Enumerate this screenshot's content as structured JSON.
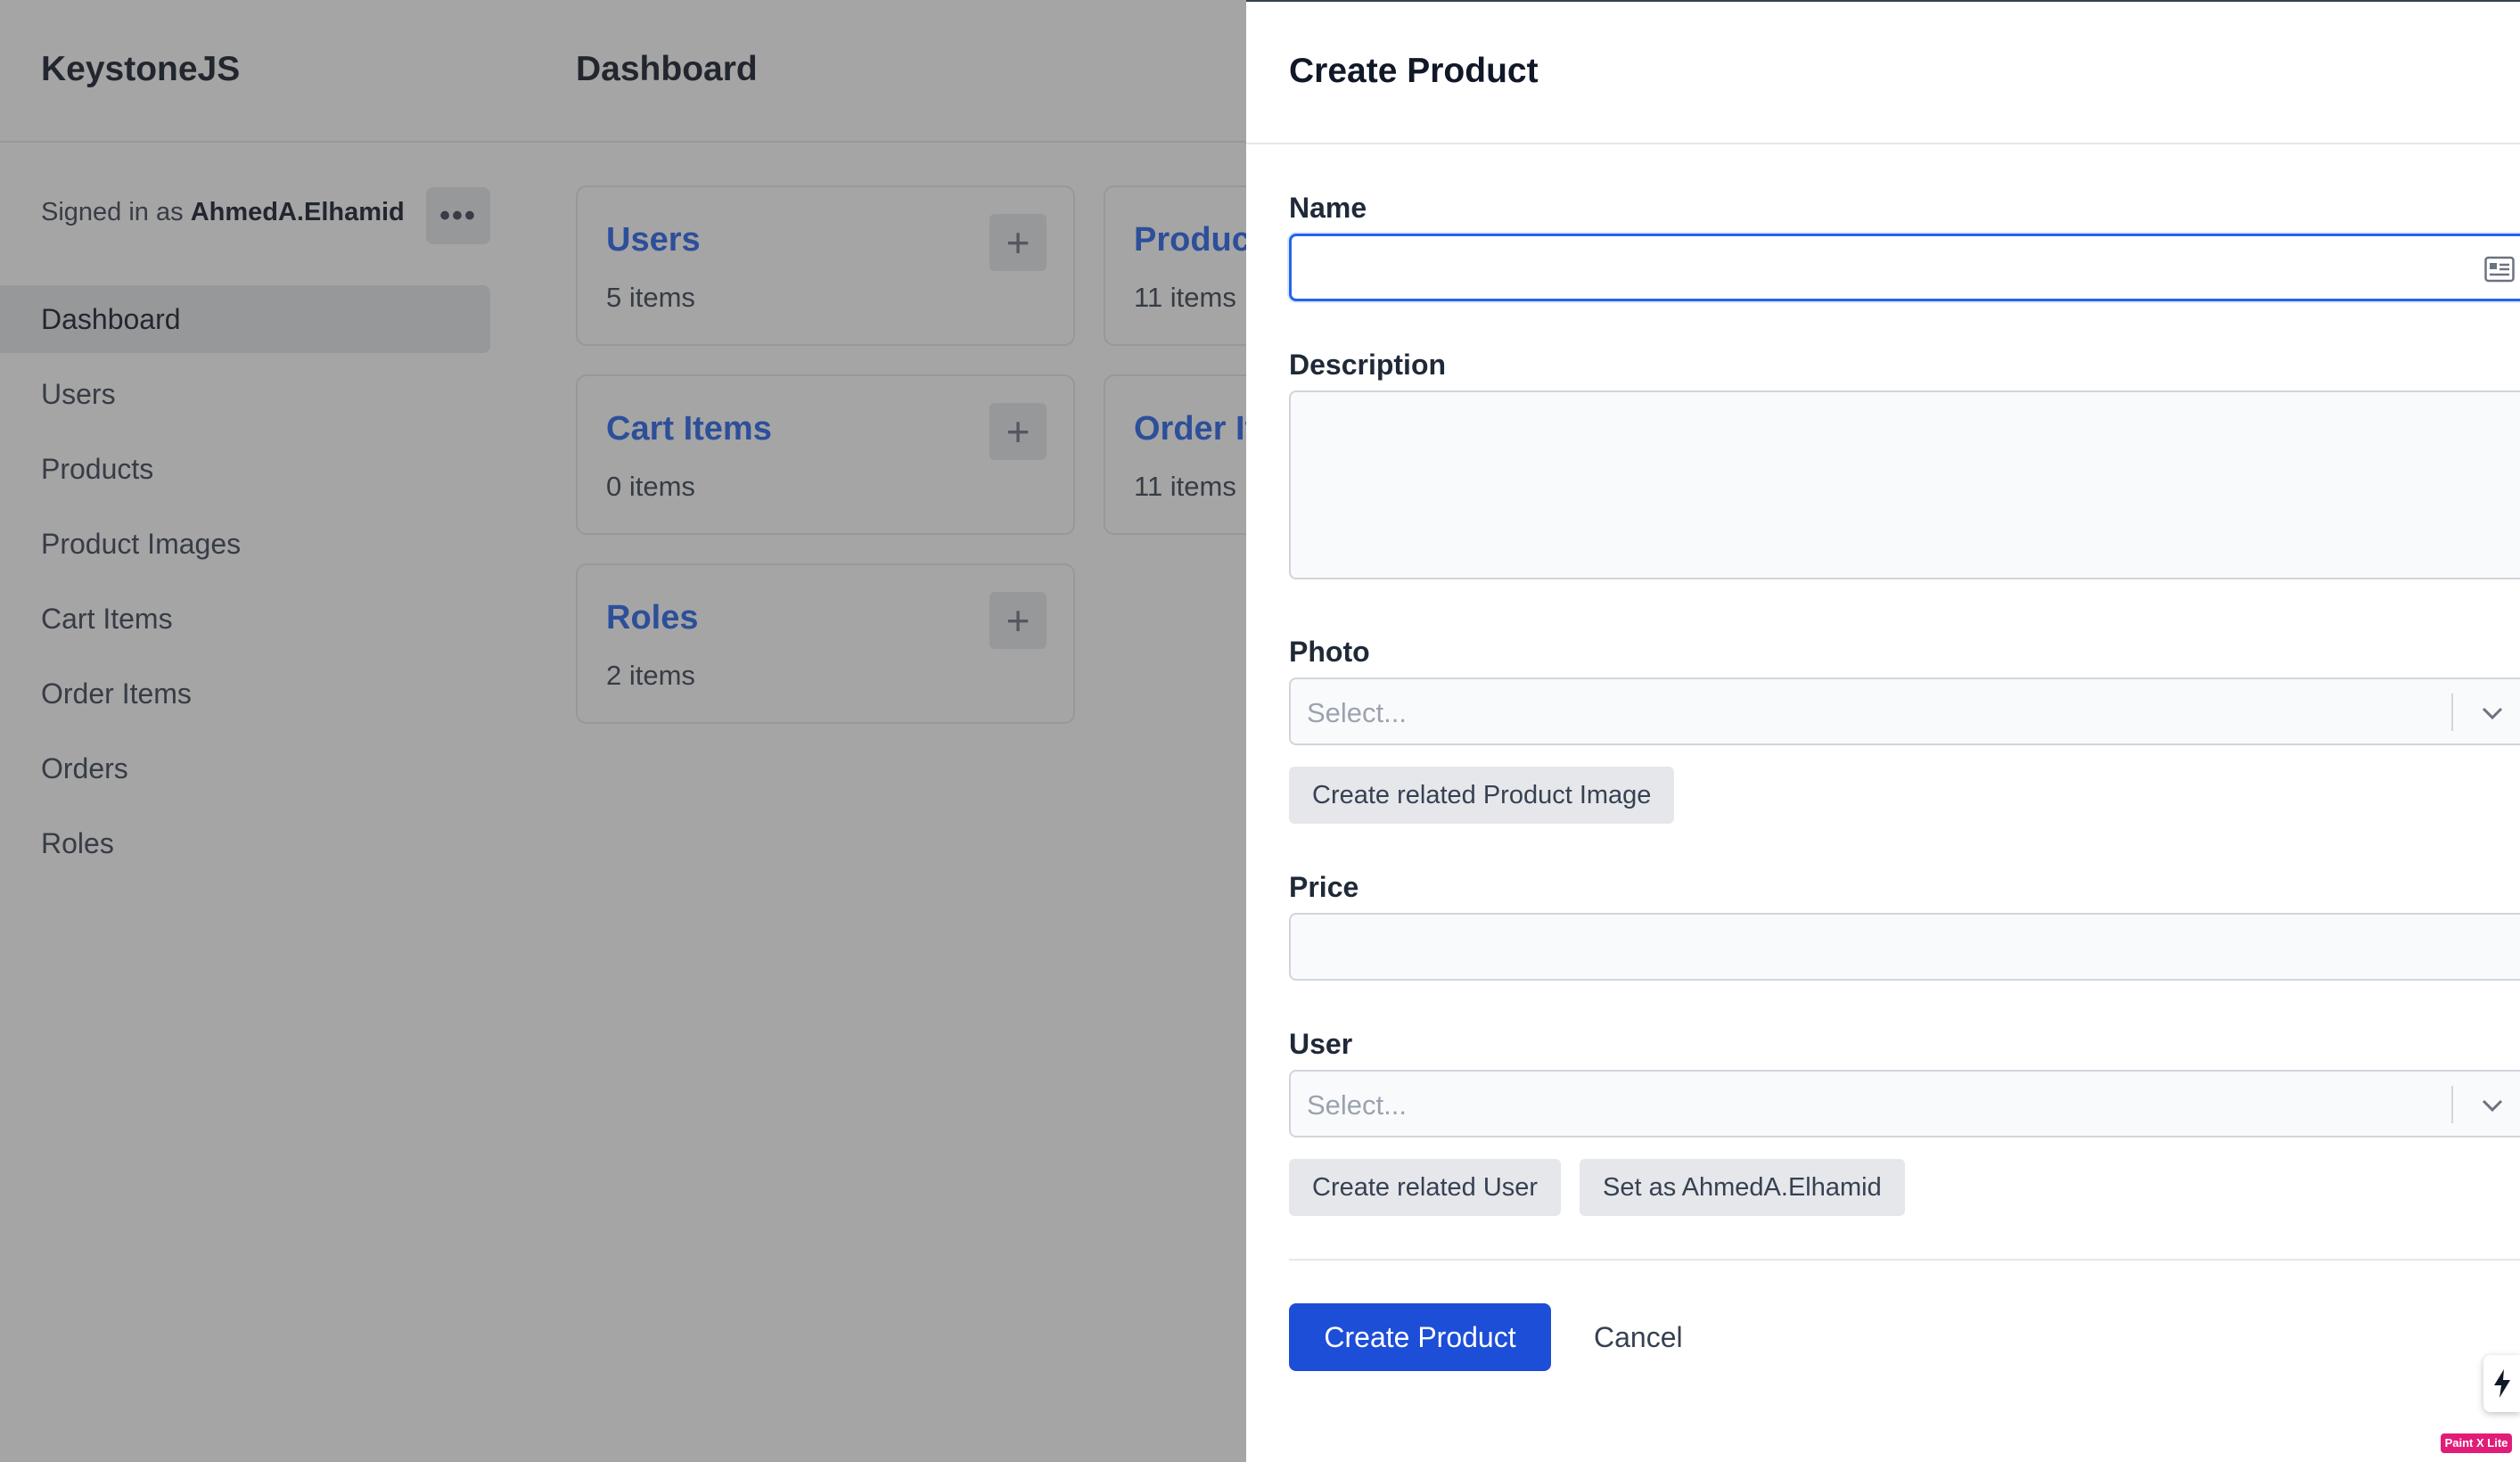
{
  "app": {
    "logo": "KeystoneJS",
    "page_title": "Dashboard"
  },
  "sidebar": {
    "signed_in_prefix": "Signed in as",
    "signed_in_user": "AhmedA.Elhamid",
    "more_label": "•••",
    "items": [
      {
        "label": "Dashboard",
        "active": true
      },
      {
        "label": "Users"
      },
      {
        "label": "Products"
      },
      {
        "label": "Product Images"
      },
      {
        "label": "Cart Items"
      },
      {
        "label": "Order Items"
      },
      {
        "label": "Orders"
      },
      {
        "label": "Roles"
      }
    ]
  },
  "cards": [
    {
      "title": "Users",
      "count": "5 items",
      "add": "+"
    },
    {
      "title": "Products",
      "count": "11 items",
      "add": "+"
    },
    {
      "title": "Cart Items",
      "count": "0 items",
      "add": "+"
    },
    {
      "title": "Order Items",
      "count": "11 items",
      "add": "+"
    },
    {
      "title": "Roles",
      "count": "2 items",
      "add": "+"
    }
  ],
  "drawer": {
    "title": "Create Product",
    "fields": {
      "name": {
        "label": "Name",
        "value": ""
      },
      "description": {
        "label": "Description",
        "value": ""
      },
      "photo": {
        "label": "Photo",
        "placeholder": "Select..."
      },
      "price": {
        "label": "Price",
        "value": ""
      },
      "user": {
        "label": "User",
        "placeholder": "Select..."
      }
    },
    "buttons": {
      "create_related_product_image": "Create related Product Image",
      "create_related_user": "Create related User",
      "set_as_user": "Set as AhmedA.Elhamid",
      "submit": "Create Product",
      "cancel": "Cancel"
    }
  },
  "overlay_badge": "Paint X Lite",
  "colors": {
    "accent": "#1d4ed8",
    "link": "#2563eb",
    "muted_bg": "#e5e7eb"
  }
}
